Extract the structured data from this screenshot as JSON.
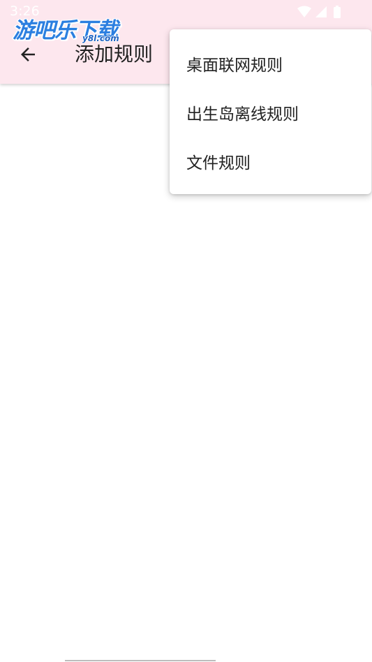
{
  "status_bar": {
    "time": "3:26",
    "icons": [
      "wifi-icon",
      "signal-icon",
      "battery-icon"
    ]
  },
  "watermark": {
    "title": "游吧乐下载",
    "url": "y8l.com"
  },
  "toolbar": {
    "back_icon": "arrow-left-icon",
    "title": "添加规则"
  },
  "menu": {
    "items": [
      {
        "label": "桌面联网规则"
      },
      {
        "label": "出生岛离线规则"
      },
      {
        "label": "文件规则"
      }
    ]
  },
  "colors": {
    "appbar_bg": "#fde7ee",
    "watermark_blue": "#2b7fe0",
    "text": "#222222"
  }
}
